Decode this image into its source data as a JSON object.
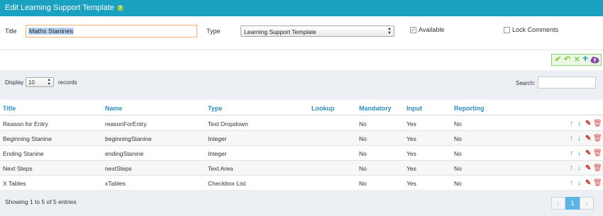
{
  "window": {
    "title": "Edit Learning Support Template",
    "help_icon": "question-circle-icon",
    "bar_color": "#1aa0c0"
  },
  "form": {
    "title_label": "Title",
    "title_value": "Maths Stanines",
    "type_label": "Type",
    "type_value": "Learning Support Template",
    "available_label": "Available",
    "available_checked": true,
    "lock_label": "Lock Comments",
    "lock_checked": false
  },
  "actions": {
    "save_icon": "✔",
    "undo_icon": "↶",
    "cancel_icon": "✕",
    "add_icon": "+",
    "upload_icon": "cloud-upload-icon"
  },
  "filter": {
    "display_label": "Display",
    "display_value": "10",
    "records_label": "records",
    "search_label": "Search:",
    "search_value": ""
  },
  "table": {
    "columns": [
      "Title",
      "Name",
      "Type",
      "Lookup",
      "Mandatory",
      "Input",
      "Reporting"
    ],
    "rows": [
      {
        "title": "Reason for Entry",
        "name": "reasonForEntry",
        "type": "Text Dropdown",
        "lookup": "",
        "mandatory": "No",
        "input": "Yes",
        "reporting": "No"
      },
      {
        "title": "Beginning Stanine",
        "name": "beginningStanine",
        "type": "Integer",
        "lookup": "",
        "mandatory": "No",
        "input": "Yes",
        "reporting": "No"
      },
      {
        "title": "Ending Stanine",
        "name": "endingStanine",
        "type": "Integer",
        "lookup": "",
        "mandatory": "No",
        "input": "Yes",
        "reporting": "No"
      },
      {
        "title": "Next Steps",
        "name": "nextSteps",
        "type": "Text Area",
        "lookup": "",
        "mandatory": "No",
        "input": "Yes",
        "reporting": "No"
      },
      {
        "title": "X Tables",
        "name": "xTables",
        "type": "Checkbox List",
        "lookup": "",
        "mandatory": "No",
        "input": "Yes",
        "reporting": "No"
      }
    ],
    "row_icons": [
      "arrow-up-icon",
      "arrow-down-icon",
      "pencil-icon",
      "trash-icon"
    ]
  },
  "footer": {
    "info": "Showing 1 to 5 of 5 entries",
    "prev": "‹",
    "page": "1",
    "next": "›"
  },
  "colors": {
    "header_text": "#2f8fc4",
    "accent_green": "#8bc34a",
    "delete_red": "#d9534f",
    "page_active": "#5bb4e4"
  }
}
